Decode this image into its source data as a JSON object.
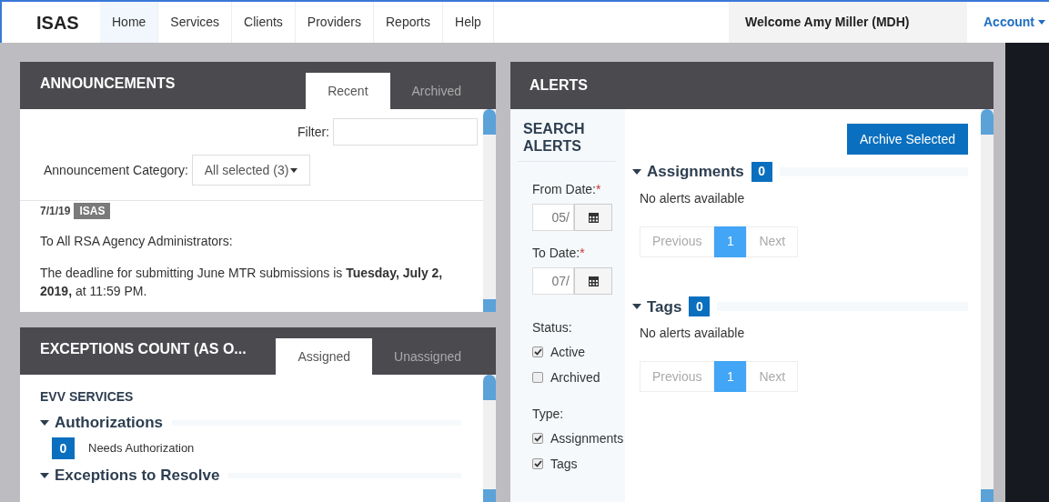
{
  "nav": {
    "brand": "ISAS",
    "items": [
      {
        "label": "Home",
        "selected": true
      },
      {
        "label": "Services",
        "selected": false
      },
      {
        "label": "Clients",
        "selected": false
      },
      {
        "label": "Providers",
        "selected": false
      },
      {
        "label": "Reports",
        "selected": false
      },
      {
        "label": "Help",
        "selected": false
      }
    ],
    "welcome": "Welcome Amy Miller (MDH)",
    "account": "Account"
  },
  "announcements": {
    "title": "ANNOUNCEMENTS",
    "tabs": [
      {
        "label": "Recent",
        "selected": true
      },
      {
        "label": "Archived",
        "selected": false
      }
    ],
    "filter_label": "Filter:",
    "category_label": "Announcement Category:",
    "category_value": "All selected (3)",
    "date": "7/1/19",
    "tag": "ISAS",
    "greeting": "To All RSA Agency Administrators:",
    "body": "The deadline for submitting June MTR submissions is **Tuesday, July 2, 2019,** at 11:59 PM."
  },
  "exceptions": {
    "title": "EXCEPTIONS COUNT (AS O...",
    "tabs": [
      {
        "label": "Assigned",
        "selected": true
      },
      {
        "label": "Unassigned",
        "selected": false
      }
    ],
    "section": "EVV SERVICES",
    "groups": [
      {
        "title": "Authorizations",
        "expanded": true,
        "items": [
          {
            "count": "0",
            "label": "Needs Authorization"
          }
        ]
      },
      {
        "title": "Exceptions to Resolve",
        "expanded": true
      }
    ]
  },
  "alerts": {
    "title": "ALERTS",
    "search": {
      "title": "SEARCH ALERTS",
      "from_label": "From Date:",
      "from_value": "05/",
      "to_label": "To Date:",
      "to_value": "07/",
      "required": "*",
      "status_label": "Status:",
      "statuses": [
        {
          "label": "Active",
          "checked": true
        },
        {
          "label": "Archived",
          "checked": false
        }
      ],
      "type_label": "Type:",
      "types": [
        {
          "label": "Assignments",
          "checked": true
        },
        {
          "label": "Tags",
          "checked": true
        }
      ]
    },
    "archive_button": "Archive Selected",
    "sections": [
      {
        "title": "Assignments",
        "count": "0",
        "expanded": true,
        "empty_text": "No alerts available",
        "previous": "Previous",
        "pages": [
          {
            "label": "1",
            "selected": true
          }
        ],
        "next": "Next"
      },
      {
        "title": "Tags",
        "count": "0",
        "expanded": true,
        "empty_text": "No alerts available",
        "previous": "Previous",
        "pages": [
          {
            "label": "1",
            "selected": true
          }
        ],
        "next": "Next"
      }
    ]
  }
}
